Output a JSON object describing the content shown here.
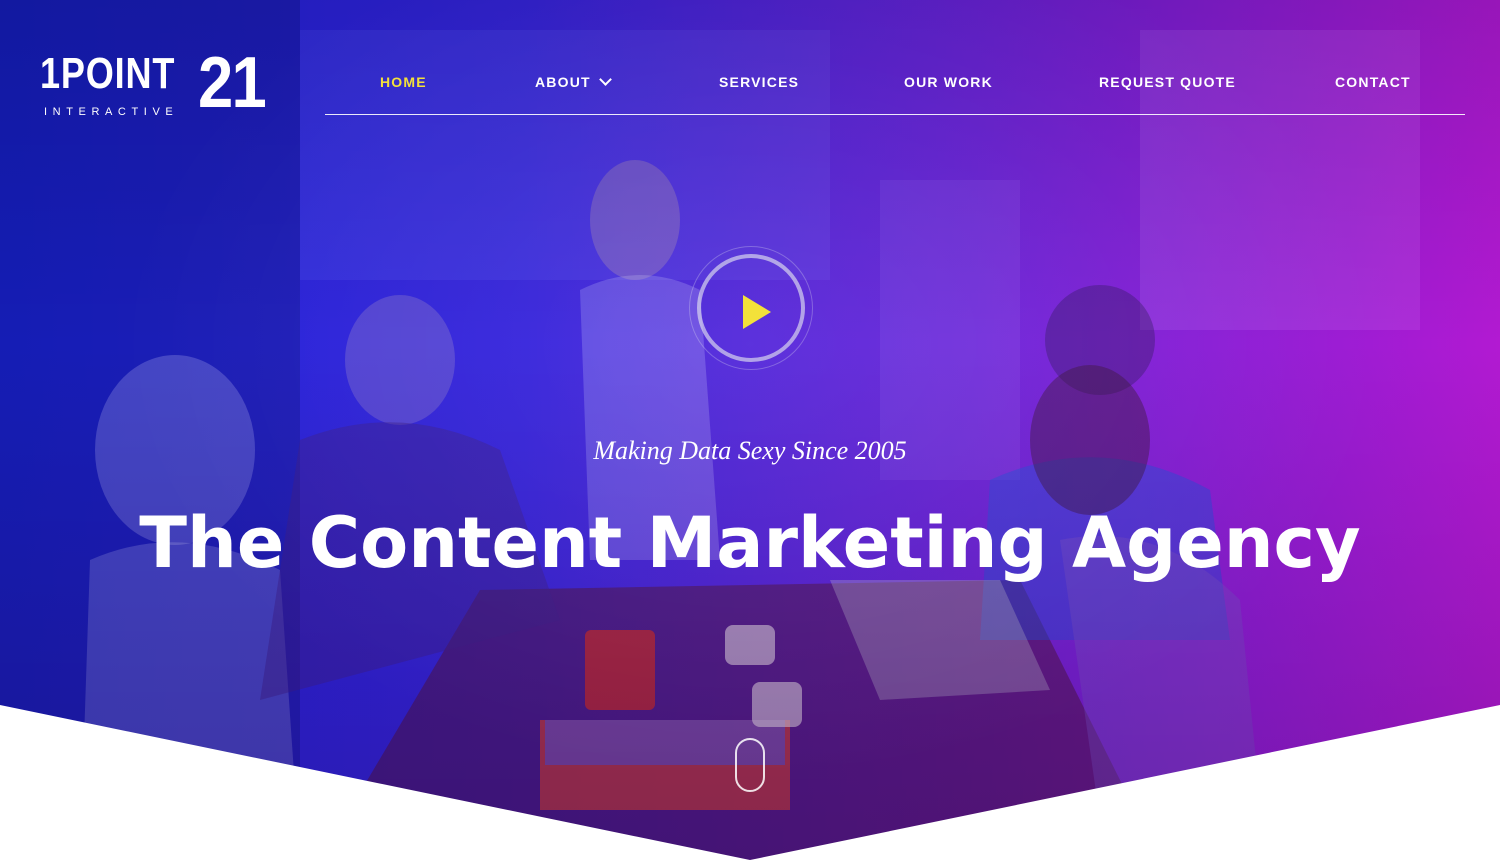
{
  "brand": {
    "logo_word": "1POINT",
    "logo_number": "21",
    "logo_subtitle": "INTERACTIVE",
    "accent_color": "#f3e13a"
  },
  "nav": {
    "items": [
      {
        "label": "HOME",
        "active": true
      },
      {
        "label": "ABOUT",
        "active": false,
        "has_dropdown": true
      },
      {
        "label": "SERVICES",
        "active": false
      },
      {
        "label": "OUR WORK",
        "active": false
      },
      {
        "label": "REQUEST QUOTE",
        "active": false
      },
      {
        "label": "CONTACT",
        "active": false
      }
    ]
  },
  "hero": {
    "tagline": "Making Data Sexy Since 2005",
    "headline": "The Content Marketing Agency",
    "play_icon": "play-icon",
    "scroll_icon": "scroll-mouse-icon",
    "gradient_colors": [
      "#1c22d6",
      "#6a21d8",
      "#b21ad2"
    ]
  }
}
